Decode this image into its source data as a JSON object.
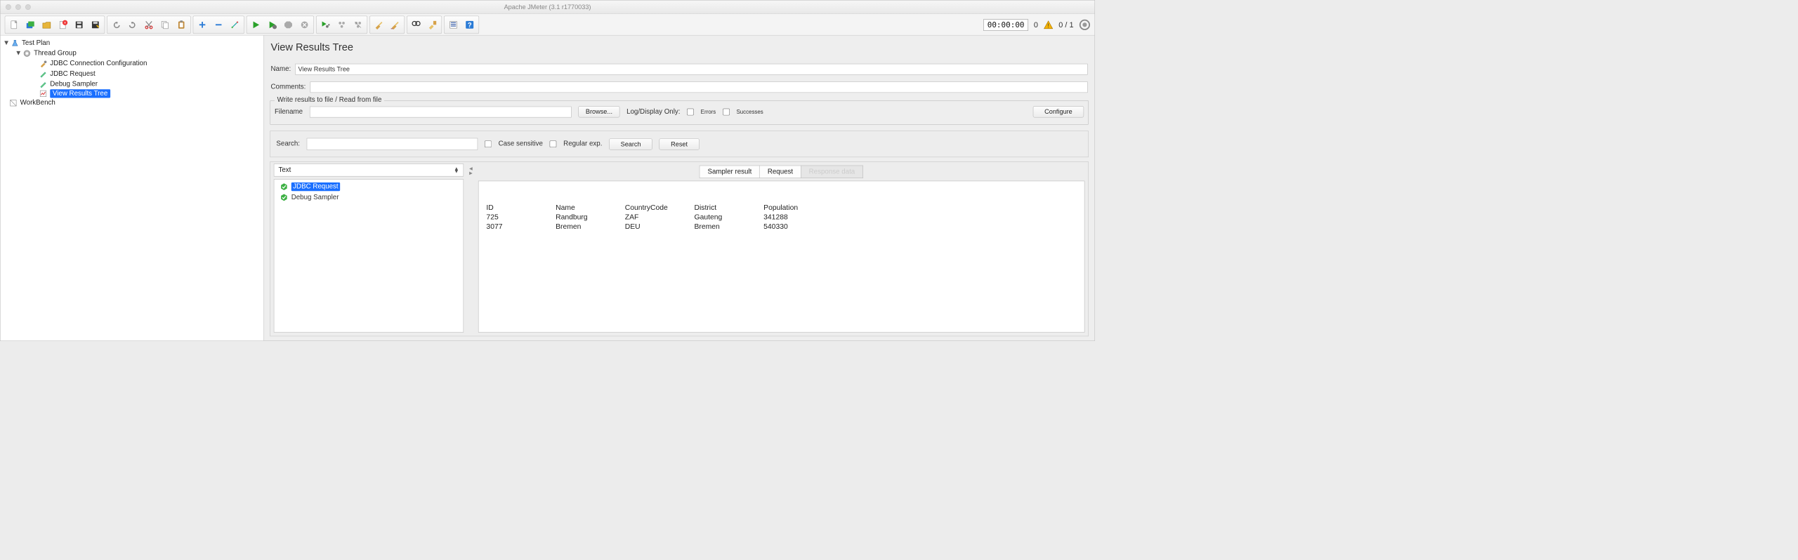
{
  "window": {
    "title": "Apache JMeter (3.1 r1770033)"
  },
  "toolbar": {
    "timer": "00:00:00",
    "warn_count": "0",
    "thread_count": "0 / 1"
  },
  "tree": {
    "root": "Test Plan",
    "thread_group": "Thread Group",
    "items": [
      "JDBC Connection Configuration",
      "JDBC Request",
      "Debug Sampler",
      "View Results Tree"
    ],
    "workbench": "WorkBench"
  },
  "main": {
    "title": "View Results Tree",
    "name_label": "Name:",
    "name_value": "View Results Tree",
    "comments_label": "Comments:",
    "comments_value": "",
    "fieldset_legend": "Write results to file / Read from file",
    "filename_label": "Filename",
    "filename_value": "",
    "browse_label": "Browse...",
    "logdisplay_label": "Log/Display Only:",
    "errors_label": "Errors",
    "successes_label": "Successes",
    "configure_label": "Configure",
    "search_label": "Search:",
    "search_value": "",
    "case_label": "Case sensitive",
    "regex_label": "Regular exp.",
    "search_btn": "Search",
    "reset_btn": "Reset",
    "view_dropdown": "Text",
    "samplers": [
      "JDBC Request",
      "Debug Sampler"
    ],
    "tabs": {
      "sampler_result": "Sampler result",
      "request": "Request",
      "response_data": "Response data"
    },
    "response": {
      "headers": [
        "ID",
        "Name",
        "CountryCode",
        "District",
        "Population"
      ],
      "rows": [
        [
          "725",
          "Randburg",
          "ZAF",
          "Gauteng",
          "341288"
        ],
        [
          "3077",
          "Bremen",
          "DEU",
          "Bremen",
          "540330"
        ]
      ]
    }
  }
}
